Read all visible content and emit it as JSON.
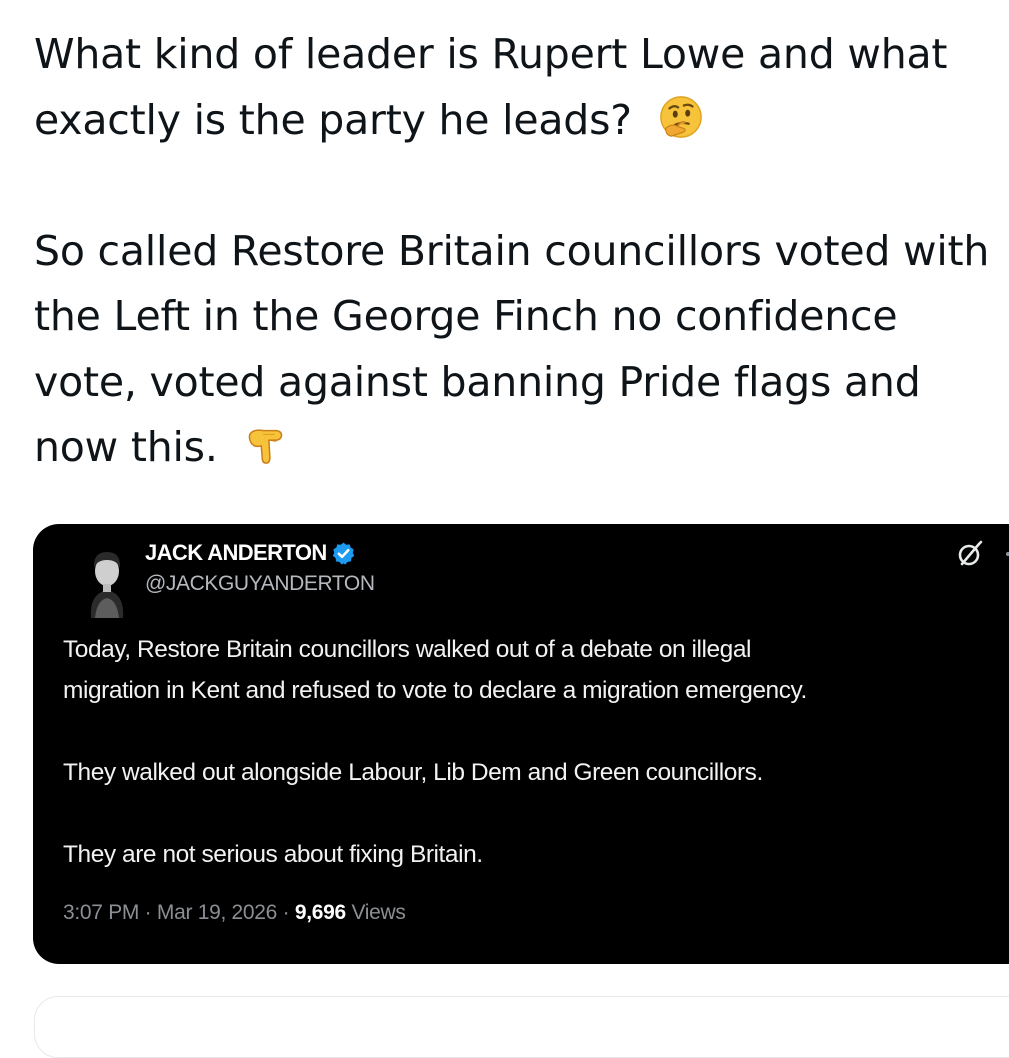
{
  "post": {
    "paragraph_1": "What kind of leader is Rupert Lowe and what exactly is the party he leads?",
    "paragraph_1_emoji": "thinking-face",
    "paragraph_2": "So called Restore Britain councillors voted with the Left in the George Finch no confidence vote, voted against banning Pride flags and now this.",
    "paragraph_2_emoji": "backhand-index-pointing-down"
  },
  "quote": {
    "author_name": "JACK ANDERTON",
    "author_handle": "@JACKGUYANDERTON",
    "verified": true,
    "body_lines": [
      "Today, Restore Britain councillors walked out of a debate on illegal",
      "migration in Kent and refused to vote to declare a migration emergency.",
      "They walked out alongside Labour, Lib Dem and Green councillors.",
      "They are not serious about fixing Britain."
    ],
    "time": "3:07 PM",
    "date": "Mar 19, 2026",
    "separator": "·",
    "views_count": "9,696",
    "views_label": "Views"
  },
  "colors": {
    "text": "#0f1419",
    "card_bg": "#000000",
    "verified_blue": "#1d9bf0",
    "meta_gray": "#8b8f93"
  }
}
